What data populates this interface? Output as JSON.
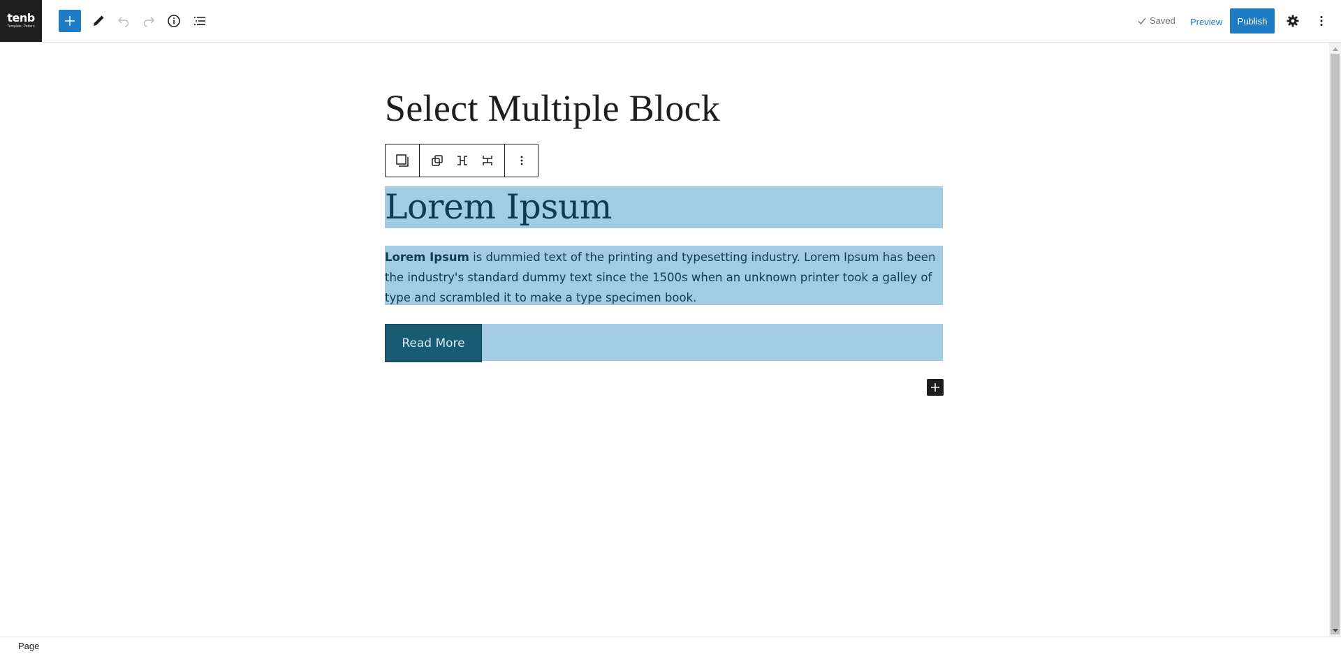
{
  "header": {
    "logo": {
      "word": "tenb",
      "tagline": "Template, Pattern"
    },
    "inserter_label": "Toggle block inserter",
    "saved_label": "Saved",
    "preview_label": "Preview",
    "publish_label": "Publish"
  },
  "editor": {
    "title": "Select Multiple Block",
    "heading": "Lorem Ipsum",
    "paragraph": {
      "bold_lead": "Lorem Ipsum",
      "rest": " is dummied text of the printing and typesetting industry. Lorem Ipsum has been the industry's standard dummy text since the 1500s when an unknown printer took a galley of type and scrambled it to make a type specimen book."
    },
    "button_label": "Read More"
  },
  "footer": {
    "breadcrumb": "Page"
  },
  "colors": {
    "accent": "#1e7cc4",
    "selection": "#a3cbe3",
    "button_bg": "#195b73",
    "text_dark": "#0e3a52"
  },
  "icons": [
    "plus-icon",
    "pencil-icon",
    "undo-icon",
    "redo-icon",
    "info-icon",
    "list-view-icon",
    "check-icon",
    "gear-icon",
    "more-vertical-icon",
    "stack-icon",
    "duplicate-icon",
    "stretch-icon",
    "collapse-icon"
  ]
}
